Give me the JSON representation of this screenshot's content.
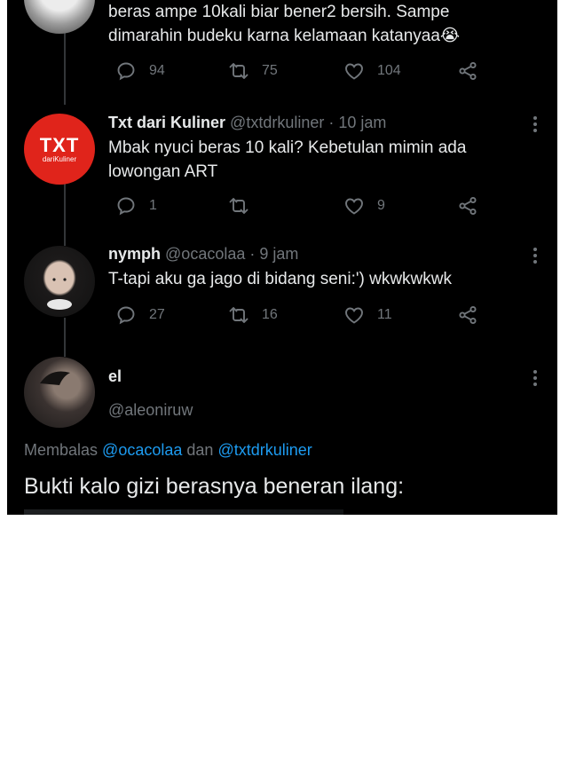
{
  "thread": [
    {
      "id": "t0",
      "text": "beras ampe 10kali biar bener2 bersih. Sampe dimarahin budeku karna kelamaan katanyaa😭",
      "replies": "94",
      "retweets": "75",
      "likes": "104"
    },
    {
      "id": "t1",
      "name": "Txt dari Kuliner",
      "handle": "@txtdrkuliner",
      "dot": "·",
      "time": "10 jam",
      "avatar_text": "TXT",
      "avatar_subtext": "dariKuliner",
      "text": "Mbak nyuci beras 10 kali? Kebetulan mimin ada lowongan ART",
      "replies": "1",
      "retweets": "",
      "likes": "9"
    },
    {
      "id": "t2",
      "name": "nymph",
      "handle": "@ocacolaa",
      "dot": "·",
      "time": "9 jam",
      "text": "T-tapi aku ga jago di bidang seni:') wkwkwkwk",
      "replies": "27",
      "retweets": "16",
      "likes": "11"
    }
  ],
  "main_tweet": {
    "name": "el",
    "handle": "@aleoniruw",
    "reply_prefix": "Membalas",
    "reply_mention_1": "@ocacolaa",
    "reply_connector": "dan",
    "reply_mention_2": "@txtdrkuliner",
    "text": "Bukti kalo gizi berasnya beneran ilang:"
  },
  "colors": {
    "background": "#000000",
    "text": "#e7e9ea",
    "muted": "#71767b",
    "link": "#1d9bf0",
    "brand_red": "#e0241b"
  },
  "icons": [
    "reply-icon",
    "retweet-icon",
    "like-icon",
    "share-icon",
    "more-icon"
  ]
}
